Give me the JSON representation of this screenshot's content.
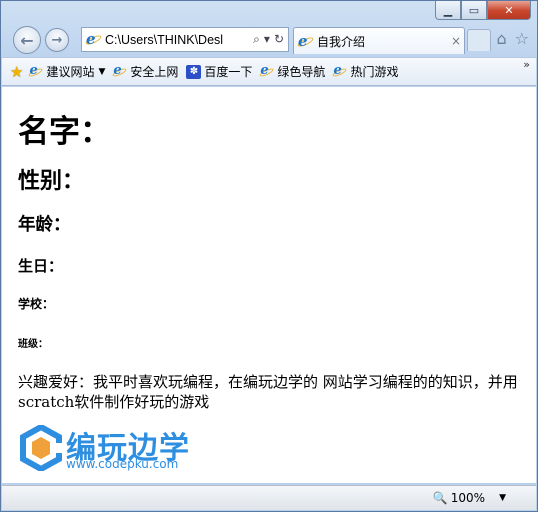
{
  "browser": {
    "address": "C:\\Users\\THINK\\Desl",
    "tab_title": "自我介绍",
    "tab_close": "×",
    "back": "←",
    "forward": "→",
    "home_icon": "⌂",
    "star_icon": "☆"
  },
  "favorites": {
    "items": [
      {
        "label": "建议网站",
        "icon": "ie"
      },
      {
        "label": "安全上网",
        "icon": "ie"
      },
      {
        "label": "百度一下",
        "icon": "paw"
      },
      {
        "label": "绿色导航",
        "icon": "ie"
      },
      {
        "label": "热门游戏",
        "icon": "ie"
      }
    ],
    "overflow": "»"
  },
  "page": {
    "name": "名字：",
    "gender": "性别：",
    "age": "年龄：",
    "birthday": "生日：",
    "school": "学校：",
    "class": "班级：",
    "hobby": "兴趣爱好：我平时喜欢玩编程，在编玩边学的 网站学习编程的的知识，并用scratch软件制作好玩的游戏",
    "logo_text": "编玩边学",
    "logo_url": "www.codepku.com"
  },
  "status": {
    "zoom": "100%"
  },
  "colors": {
    "logo_blue": "#2e8ee0",
    "logo_orange": "#f0a23a"
  }
}
